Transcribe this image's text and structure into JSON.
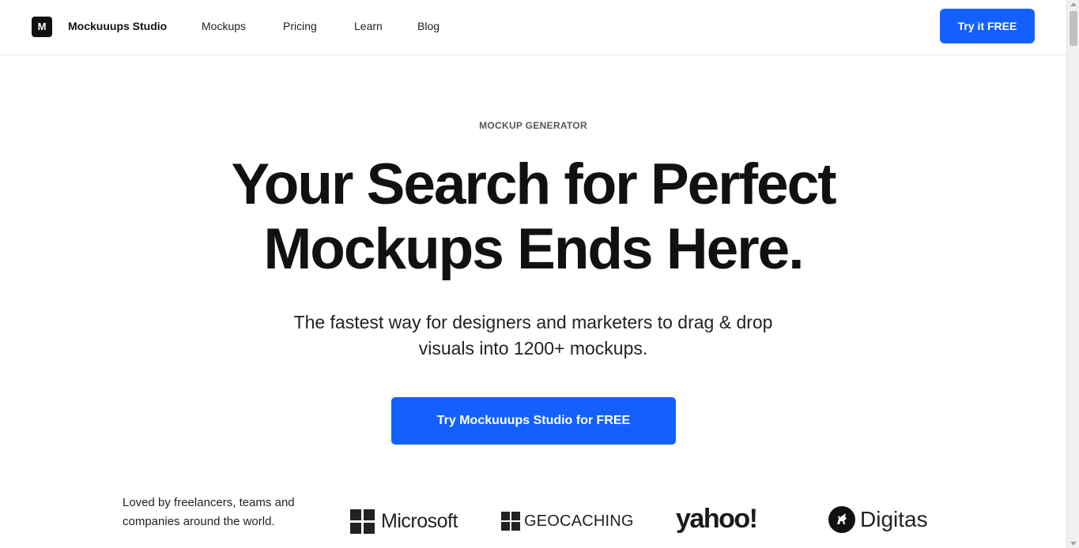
{
  "header": {
    "logo_letter": "M",
    "brand": "Mockuuups Studio",
    "nav": {
      "mockups": "Mockups",
      "pricing": "Pricing",
      "learn": "Learn",
      "blog": "Blog"
    },
    "cta_label": "Try it FREE"
  },
  "hero": {
    "eyebrow": "MOCKUP GENERATOR",
    "headline_line1": "Your Search for Perfect",
    "headline_line2": "Mockups Ends Here.",
    "subtitle_line1": "The fastest way for designers and marketers to drag & drop",
    "subtitle_line2": "visuals into 1200+ mockups.",
    "cta_label": "Try Mockuuups Studio for FREE"
  },
  "social_proof": {
    "text": "Loved by freelancers, teams and companies around the world.",
    "logos": {
      "microsoft": "Microsoft",
      "geocaching": "GEOCACHING",
      "yahoo": "yahoo!",
      "digitas": "Digitas"
    }
  },
  "colors": {
    "accent": "#1360ff",
    "text": "#111111"
  }
}
